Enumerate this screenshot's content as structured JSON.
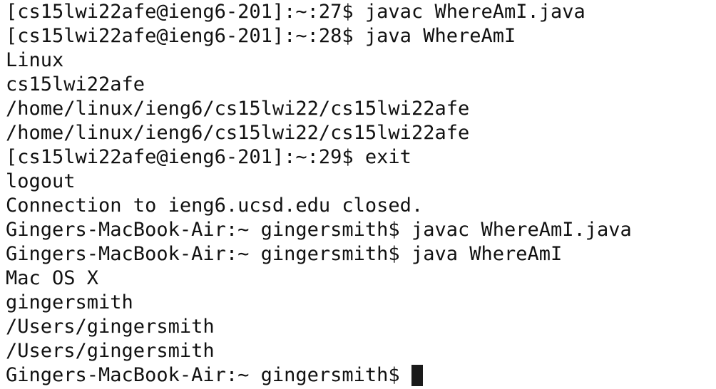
{
  "terminal": {
    "lines": [
      "[cs15lwi22afe@ieng6-201]:~:27$ javac WhereAmI.java",
      "[cs15lwi22afe@ieng6-201]:~:28$ java WhereAmI",
      "Linux",
      "cs15lwi22afe",
      "/home/linux/ieng6/cs15lwi22/cs15lwi22afe",
      "/home/linux/ieng6/cs15lwi22/cs15lwi22afe",
      "[cs15lwi22afe@ieng6-201]:~:29$ exit",
      "logout",
      "Connection to ieng6.ucsd.edu closed.",
      "Gingers-MacBook-Air:~ gingersmith$ javac WhereAmI.java",
      "Gingers-MacBook-Air:~ gingersmith$ java WhereAmI",
      "Mac OS X",
      "gingersmith",
      "/Users/gingersmith",
      "/Users/gingersmith"
    ],
    "prompt": "Gingers-MacBook-Air:~ gingersmith$",
    "colors": {
      "background": "#ffffff",
      "text": "#111111",
      "cursor": "#1a1a1a"
    }
  }
}
